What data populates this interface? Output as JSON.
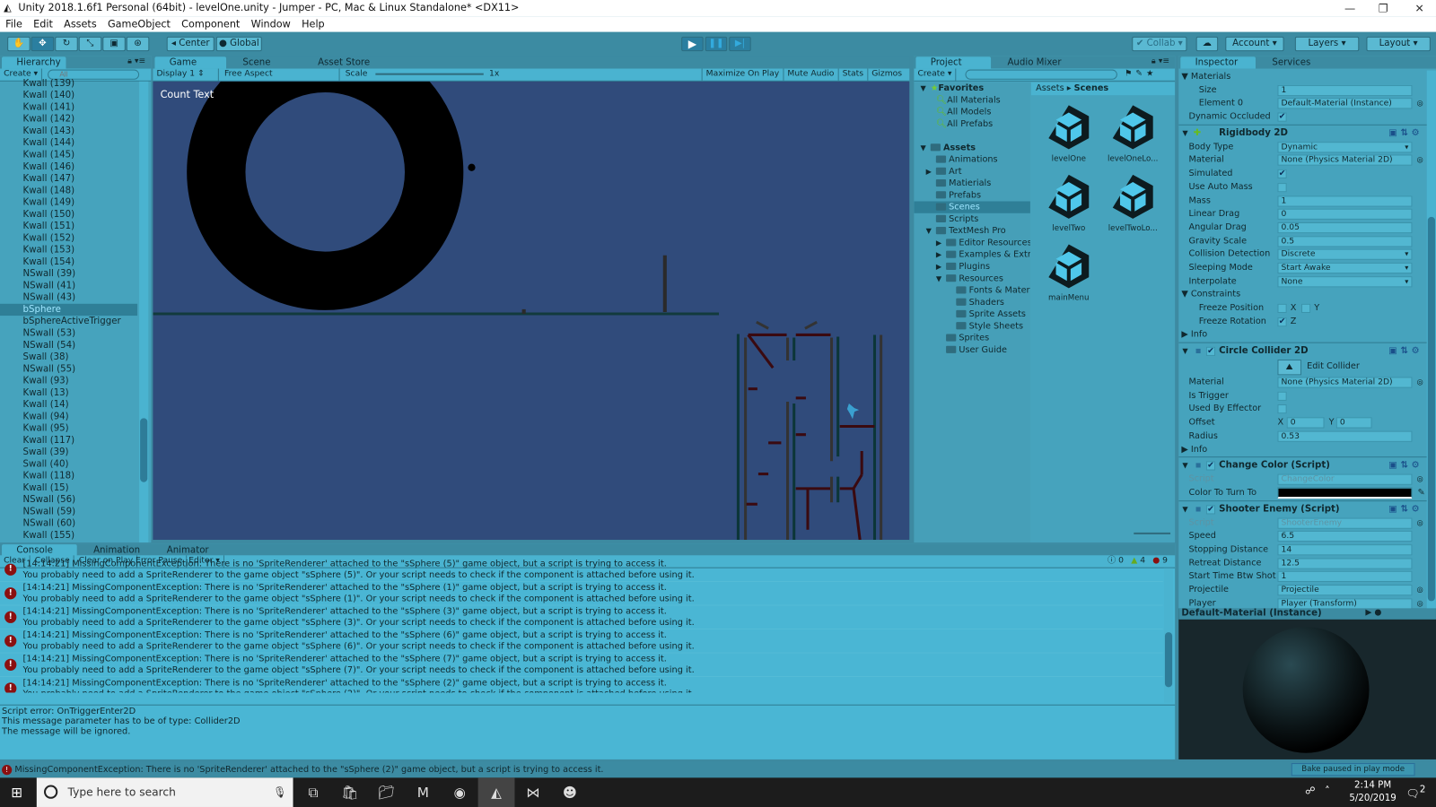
{
  "window": {
    "title": "Unity 2018.1.6f1 Personal (64bit) - levelOne.unity - Jumper - PC, Mac & Linux Standalone* <DX11>"
  },
  "menu": [
    "File",
    "Edit",
    "Assets",
    "GameObject",
    "Component",
    "Window",
    "Help"
  ],
  "toolbar": {
    "tools": [
      "hand-icon",
      "move-icon",
      "rotate-icon",
      "scale-icon",
      "rect-icon",
      "transform-icon"
    ],
    "active_tool": 1,
    "pivot": "Center",
    "space": "Global",
    "play_state": "playing",
    "collab": "Collab",
    "account": "Account",
    "layers": "Layers",
    "layout": "Layout"
  },
  "hierarchy": {
    "tab": "Hierarchy",
    "create": "Create",
    "search_placeholder": "All",
    "items": [
      "Kwall (139)",
      "Kwall (140)",
      "Kwall (141)",
      "Kwall (142)",
      "Kwall (143)",
      "Kwall (144)",
      "Kwall (145)",
      "Kwall (146)",
      "Kwall (147)",
      "Kwall (148)",
      "Kwall (149)",
      "Kwall (150)",
      "Kwall (151)",
      "Kwall (152)",
      "Kwall (153)",
      "Kwall (154)",
      "NSwall (39)",
      "NSwall (41)",
      "NSwall (43)",
      "bSphere",
      "bSphereActiveTrigger",
      "NSwall (53)",
      "NSwall (54)",
      "Swall (38)",
      "NSwall (55)",
      "Kwall (93)",
      "Kwall (13)",
      "Kwall (14)",
      "Kwall (94)",
      "Kwall (95)",
      "Kwall (117)",
      "Swall (39)",
      "Swall (40)",
      "Kwall (118)",
      "Kwall (15)",
      "NSwall (56)",
      "NSwall (59)",
      "NSwall (60)",
      "Kwall (155)"
    ],
    "selected": "bSphere"
  },
  "game": {
    "tabs": [
      "Game",
      "Scene",
      "Asset Store"
    ],
    "display": "Display 1",
    "aspect": "Free Aspect",
    "scale_label": "Scale",
    "scale_value": "1x",
    "buttons": [
      "Maximize On Play",
      "Mute Audio",
      "Stats",
      "Gizmos"
    ],
    "count_text": "Count Text"
  },
  "project": {
    "tabs": [
      "Project",
      "Audio Mixer"
    ],
    "create": "Create",
    "breadcrumb": [
      "Assets",
      "Scenes"
    ],
    "favorites_label": "Favorites",
    "favorites": [
      "All Materials",
      "All Models",
      "All Prefabs"
    ],
    "assets_label": "Assets",
    "tree": [
      {
        "name": "Animations",
        "depth": 1
      },
      {
        "name": "Art",
        "depth": 1,
        "arrow": "▶"
      },
      {
        "name": "Matierials",
        "depth": 1
      },
      {
        "name": "Prefabs",
        "depth": 1
      },
      {
        "name": "Scenes",
        "depth": 1,
        "selected": true
      },
      {
        "name": "Scripts",
        "depth": 1
      },
      {
        "name": "TextMesh Pro",
        "depth": 1,
        "arrow": "▼"
      },
      {
        "name": "Editor Resources",
        "depth": 2,
        "arrow": "▶"
      },
      {
        "name": "Examples & Extr",
        "depth": 2,
        "arrow": "▶"
      },
      {
        "name": "Plugins",
        "depth": 2,
        "arrow": "▶"
      },
      {
        "name": "Resources",
        "depth": 2,
        "arrow": "▼"
      },
      {
        "name": "Fonts & Materi",
        "depth": 3
      },
      {
        "name": "Shaders",
        "depth": 3
      },
      {
        "name": "Sprite Assets",
        "depth": 3
      },
      {
        "name": "Style Sheets",
        "depth": 3
      },
      {
        "name": "Sprites",
        "depth": 2
      },
      {
        "name": "User Guide",
        "depth": 2
      }
    ],
    "scenes": [
      "levelOne",
      "levelOneLo...",
      "levelTwo",
      "levelTwoLo...",
      "mainMenu"
    ]
  },
  "inspector": {
    "tabs": [
      "Inspector",
      "Services"
    ],
    "rows": [
      {
        "kind": "fold",
        "label": "Materials"
      },
      {
        "kind": "field",
        "label": "Size",
        "value": "1",
        "indent": true
      },
      {
        "kind": "object",
        "label": "Element 0",
        "value": "Default-Material (Instance)",
        "indent": true
      },
      {
        "kind": "check",
        "label": "Dynamic Occluded",
        "checked": true
      },
      {
        "kind": "header",
        "label": "Rigidbody 2D",
        "icon": "rigidbody-icon"
      },
      {
        "kind": "dropdown",
        "label": "Body Type",
        "value": "Dynamic"
      },
      {
        "kind": "object",
        "label": "Material",
        "value": "None (Physics Material 2D)"
      },
      {
        "kind": "check",
        "label": "Simulated",
        "checked": true
      },
      {
        "kind": "check",
        "label": "Use Auto Mass",
        "checked": false
      },
      {
        "kind": "field",
        "label": "Mass",
        "value": "1"
      },
      {
        "kind": "field",
        "label": "Linear Drag",
        "value": "0"
      },
      {
        "kind": "field",
        "label": "Angular Drag",
        "value": "0.05"
      },
      {
        "kind": "field",
        "label": "Gravity Scale",
        "value": "0.5"
      },
      {
        "kind": "dropdown",
        "label": "Collision Detection",
        "value": "Discrete"
      },
      {
        "kind": "dropdown",
        "label": "Sleeping Mode",
        "value": "Start Awake"
      },
      {
        "kind": "dropdown",
        "label": "Interpolate",
        "value": "None"
      },
      {
        "kind": "fold",
        "label": "Constraints"
      },
      {
        "kind": "axes",
        "label": "Freeze Position",
        "axes": [
          {
            "name": "X",
            "checked": false
          },
          {
            "name": "Y",
            "checked": false
          }
        ]
      },
      {
        "kind": "axes",
        "label": "Freeze Rotation",
        "axes": [
          {
            "name": "Z",
            "checked": true
          }
        ]
      },
      {
        "kind": "foldclosed",
        "label": "Info"
      },
      {
        "kind": "header",
        "label": "Circle Collider 2D",
        "icon": "circle-collider-icon",
        "toggle": true
      },
      {
        "kind": "editbtn",
        "label": "Edit Collider"
      },
      {
        "kind": "object",
        "label": "Material",
        "value": "None (Physics Material 2D)"
      },
      {
        "kind": "check",
        "label": "Is Trigger",
        "checked": false
      },
      {
        "kind": "check",
        "label": "Used By Effector",
        "checked": false
      },
      {
        "kind": "vec2",
        "label": "Offset",
        "x": "0",
        "y": "0"
      },
      {
        "kind": "field",
        "label": "Radius",
        "value": "0.53"
      },
      {
        "kind": "foldclosed",
        "label": "Info"
      },
      {
        "kind": "header",
        "label": "Change Color (Script)",
        "icon": "script-icon",
        "toggle": true
      },
      {
        "kind": "disabled",
        "label": "Script",
        "value": "ChangeColor"
      },
      {
        "kind": "color",
        "label": "Color To Turn To",
        "value": "#000000"
      },
      {
        "kind": "header",
        "label": "Shooter Enemy (Script)",
        "icon": "script-icon",
        "toggle": true
      },
      {
        "kind": "disabled",
        "label": "Script",
        "value": "ShooterEnemy"
      },
      {
        "kind": "field",
        "label": "Speed",
        "value": "6.5"
      },
      {
        "kind": "field",
        "label": "Stopping Distance",
        "value": "14"
      },
      {
        "kind": "field",
        "label": "Retreat Distance",
        "value": "12.5"
      },
      {
        "kind": "field",
        "label": "Start Time Btw Shot",
        "value": "1"
      },
      {
        "kind": "object",
        "label": "Projectile",
        "value": "Projectile"
      },
      {
        "kind": "object",
        "label": "Player",
        "value": "Player (Transform)"
      }
    ],
    "preview_title": "Default-Material (Instance)",
    "bake_status": "Bake paused in play mode"
  },
  "console": {
    "tabs": [
      "Console",
      "Animation",
      "Animator"
    ],
    "buttons": [
      "Clear",
      "Collapse",
      "Clear on Play",
      "Error Pause",
      "Editor"
    ],
    "counts": {
      "info": "0",
      "warnings": "4",
      "errors": "9"
    },
    "entries": [
      {
        "line1": "[14:14:21] MissingComponentException: There is no 'SpriteRenderer' attached to the \"sSphere (5)\" game object, but a script is trying to access it.",
        "line2": "You probably need to add a SpriteRenderer to the game object \"sSphere (5)\". Or your script needs to check if the component is attached before using it."
      },
      {
        "line1": "[14:14:21] MissingComponentException: There is no 'SpriteRenderer' attached to the \"sSphere (1)\" game object, but a script is trying to access it.",
        "line2": "You probably need to add a SpriteRenderer to the game object \"sSphere (1)\". Or your script needs to check if the component is attached before using it."
      },
      {
        "line1": "[14:14:21] MissingComponentException: There is no 'SpriteRenderer' attached to the \"sSphere (3)\" game object, but a script is trying to access it.",
        "line2": "You probably need to add a SpriteRenderer to the game object \"sSphere (3)\". Or your script needs to check if the component is attached before using it."
      },
      {
        "line1": "[14:14:21] MissingComponentException: There is no 'SpriteRenderer' attached to the \"sSphere (6)\" game object, but a script is trying to access it.",
        "line2": "You probably need to add a SpriteRenderer to the game object \"sSphere (6)\". Or your script needs to check if the component is attached before using it."
      },
      {
        "line1": "[14:14:21] MissingComponentException: There is no 'SpriteRenderer' attached to the \"sSphere (7)\" game object, but a script is trying to access it.",
        "line2": "You probably need to add a SpriteRenderer to the game object \"sSphere (7)\". Or your script needs to check if the component is attached before using it."
      },
      {
        "line1": "[14:14:21] MissingComponentException: There is no 'SpriteRenderer' attached to the \"sSphere (2)\" game object, but a script is trying to access it.",
        "line2": "You probably need to add a SpriteRenderer to the game object \"sSphere (2)\". Or your script needs to check if the component is attached before using it."
      }
    ],
    "detail": [
      "Script error: OnTriggerEnter2D",
      "This message parameter has to be of type: Collider2D",
      "The message will be ignored."
    ]
  },
  "status_bar": "MissingComponentException: There is no 'SpriteRenderer' attached to the \"sSphere (2)\" game object, but a script is trying to access it.",
  "taskbar": {
    "search_placeholder": "Type here to search",
    "time": "2:14 PM",
    "date": "5/20/2019",
    "notifications": "2",
    "apps": [
      "task-view-icon",
      "store-icon",
      "file-explorer-icon",
      "maya-icon",
      "chrome-icon",
      "unity-icon",
      "visual-studio-icon",
      "game-icon"
    ]
  }
}
